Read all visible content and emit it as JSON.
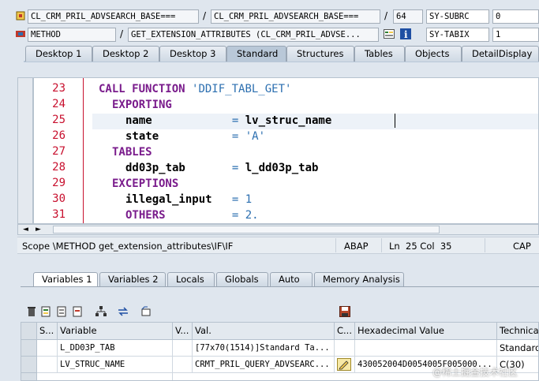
{
  "header": {
    "row1": {
      "program": "CL_CRM_PRIL_ADVSEARCH_BASE===",
      "include": "CL_CRM_PRIL_ADVSEARCH_BASE===",
      "line": "64",
      "sysvar": "SY-SUBRC",
      "sysval": "0"
    },
    "row2": {
      "event_type": "METHOD",
      "event": "GET_EXTENSION_ATTRIBUTES (CL_CRM_PRIL_ADVSE...",
      "sysvar": "SY-TABIX",
      "sysval": "1"
    },
    "sep": "/"
  },
  "main_tabs": [
    "Desktop 1",
    "Desktop 2",
    "Desktop 3",
    "Standard",
    "Structures",
    "Tables",
    "Objects",
    "DetailDisplay"
  ],
  "code": {
    "lines": [
      {
        "no": "23",
        "parts": [
          {
            "t": "CALL FUNCTION ",
            "c": "kw"
          },
          {
            "t": "'DDIF_TABL_GET'",
            "c": "st"
          }
        ],
        "indent": 4
      },
      {
        "no": "24",
        "parts": [
          {
            "t": "EXPORTING",
            "c": "kw"
          }
        ],
        "indent": 6
      },
      {
        "no": "25",
        "parts": [
          {
            "t": "name            ",
            "c": ""
          },
          {
            "t": "= ",
            "c": "nm"
          },
          {
            "t": "lv_struc_name",
            "c": ""
          }
        ],
        "indent": 8
      },
      {
        "no": "26",
        "parts": [
          {
            "t": "state           ",
            "c": ""
          },
          {
            "t": "= ",
            "c": "nm"
          },
          {
            "t": "'A'",
            "c": "st"
          }
        ],
        "indent": 8
      },
      {
        "no": "27",
        "parts": [
          {
            "t": "TABLES",
            "c": "kw"
          }
        ],
        "indent": 6
      },
      {
        "no": "28",
        "parts": [
          {
            "t": "dd03p_tab       ",
            "c": ""
          },
          {
            "t": "= ",
            "c": "nm"
          },
          {
            "t": "l_dd03p_tab",
            "c": ""
          }
        ],
        "indent": 8
      },
      {
        "no": "29",
        "parts": [
          {
            "t": "EXCEPTIONS",
            "c": "kw"
          }
        ],
        "indent": 6
      },
      {
        "no": "30",
        "parts": [
          {
            "t": "illegal_input   ",
            "c": ""
          },
          {
            "t": "= 1",
            "c": "nm"
          }
        ],
        "indent": 8
      },
      {
        "no": "31",
        "parts": [
          {
            "t": "OTHERS          ",
            "c": "kw"
          },
          {
            "t": "= 2.",
            "c": "nm"
          }
        ],
        "indent": 8
      }
    ]
  },
  "status": {
    "scope": "Scope \\METHOD get_extension_attributes\\IF\\IF",
    "lang": "ABAP",
    "pos": "Ln  25 Col  35",
    "caps": "CAP"
  },
  "var_tabs": [
    "Variables 1",
    "Variables 2",
    "Locals",
    "Globals",
    "Auto",
    "Memory Analysis"
  ],
  "table": {
    "headers": [
      "S...",
      "Variable",
      "V...",
      "Val.",
      "C...",
      "Hexadecimal Value",
      "Technical"
    ],
    "rows": [
      {
        "variable": "L_DD03P_TAB",
        "value": "[77x70(1514)]Standard Ta...",
        "hex": "",
        "tech": "Standard"
      },
      {
        "variable": "LV_STRUC_NAME",
        "value": "CRMT_PRIL_QUERY_ADVSEARC...",
        "hex": "430052004D0054005F005000...",
        "tech": "C(30)"
      }
    ]
  },
  "watermark": "@稀土掘金技术社区",
  "colors": {
    "keyword": "#7a1c8c",
    "literal": "#2c6fb0",
    "linenumber": "#c8102e"
  }
}
